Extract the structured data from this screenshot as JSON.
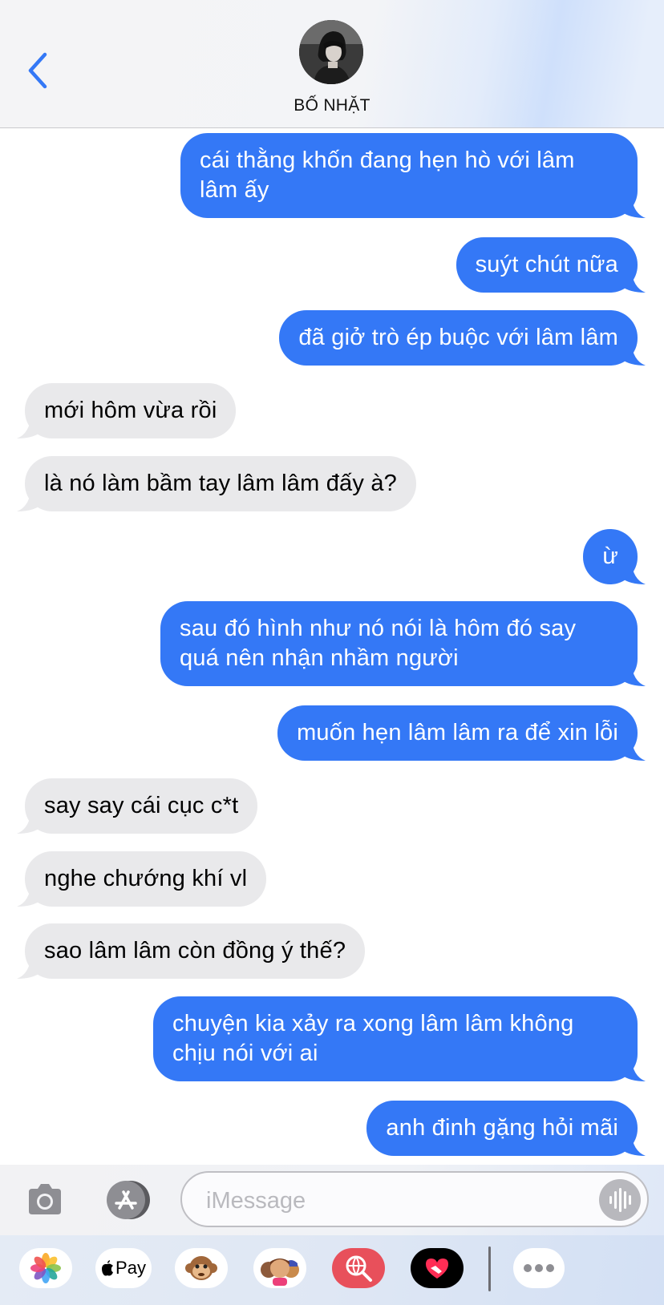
{
  "header": {
    "contact_name": "BỐ NHẶT",
    "back_icon": "chevron-left-icon",
    "avatar": "contact-photo"
  },
  "messages": [
    {
      "from": "me",
      "text": "cái thằng khốn đang hẹn hò với lâm lâm ấy"
    },
    {
      "from": "me",
      "text": "suýt chút nữa"
    },
    {
      "from": "me",
      "text": "đã giở trò ép buộc với lâm lâm"
    },
    {
      "from": "other",
      "text": "mới hôm vừa rồi"
    },
    {
      "from": "other",
      "text": "là nó làm bầm tay lâm lâm đấy à?"
    },
    {
      "from": "me",
      "text": "ừ"
    },
    {
      "from": "me",
      "text": "sau đó hình như nó nói là hôm đó say quá nên nhận nhầm người"
    },
    {
      "from": "me",
      "text": "muốn hẹn lâm lâm ra để xin lỗi"
    },
    {
      "from": "other",
      "text": "say say cái cục c*t"
    },
    {
      "from": "other",
      "text": "nghe chướng khí vl"
    },
    {
      "from": "other",
      "text": "sao lâm lâm còn đồng ý thế?"
    },
    {
      "from": "me",
      "text": "chuyện kia xảy ra xong lâm lâm không chịu nói với ai"
    },
    {
      "from": "me",
      "text": "anh đinh gặng hỏi mãi"
    }
  ],
  "input": {
    "placeholder": "iMessage",
    "value": ""
  },
  "drawer": {
    "apple_pay_label": "Pay",
    "apps": [
      "photos-icon",
      "apple-pay-icon",
      "animoji-icon",
      "memoji-stickers-icon",
      "web-search-icon",
      "digital-touch-icon",
      "more-icon"
    ]
  },
  "colors": {
    "outgoing_bubble": "#3478f6",
    "incoming_bubble": "#e9e9eb",
    "accent": "#3478f6"
  }
}
